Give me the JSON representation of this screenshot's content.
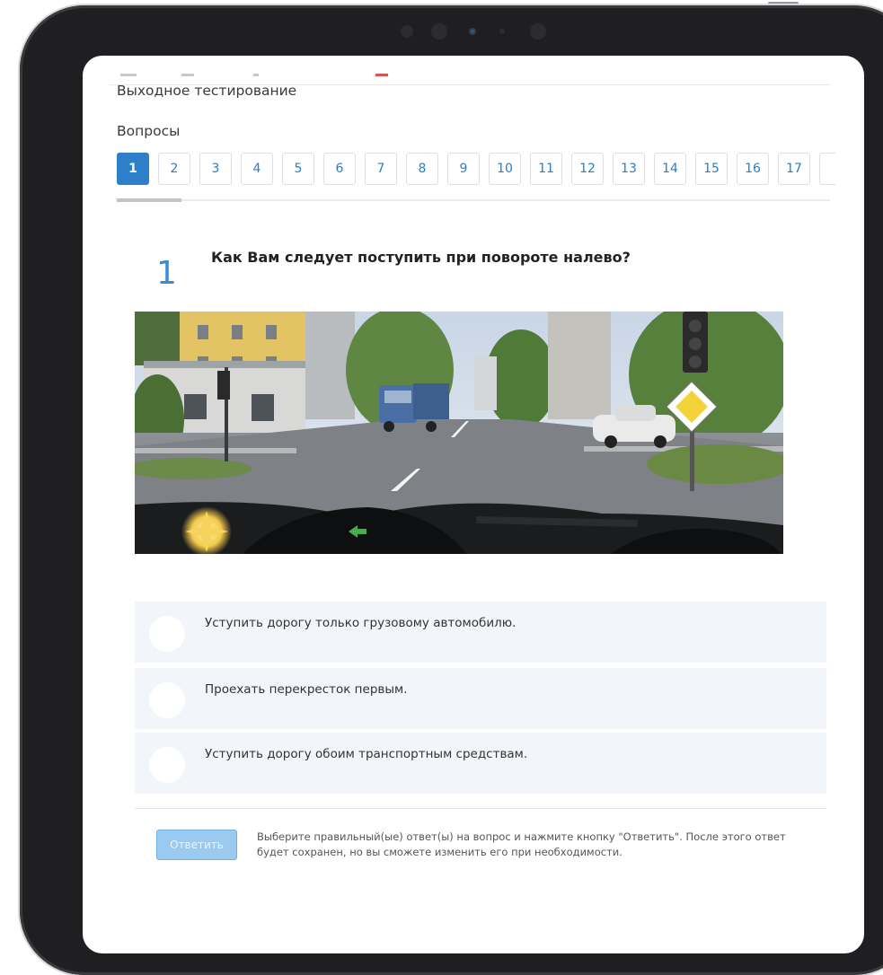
{
  "header": {
    "test_title": "Выходное тестирование",
    "questions_label": "Вопросы"
  },
  "pager": {
    "active": "1",
    "pages": [
      "1",
      "2",
      "3",
      "4",
      "5",
      "6",
      "7",
      "8",
      "9",
      "10",
      "11",
      "12",
      "13",
      "14",
      "15",
      "16",
      "17"
    ]
  },
  "question": {
    "number": "1",
    "text": "Как Вам следует поступить при повороте налево?"
  },
  "answers": [
    {
      "label": "Уступить дорогу только грузовому автомобилю."
    },
    {
      "label": "Проехать перекресток первым."
    },
    {
      "label": "Уступить дорогу обоим транспортным средствам."
    }
  ],
  "footer": {
    "submit_label": "Ответить",
    "hint": "Выберите правильный(ые) ответ(ы) на вопрос и нажмите кнопку \"Ответить\". После этого ответ будет сохранен, но вы сможете изменить его при необходимости."
  },
  "colors": {
    "accent": "#2c7fc8",
    "question_number": "#3a8bd6",
    "answer_bg": "#f2f5f9",
    "device_frame": "#1f1f21"
  }
}
